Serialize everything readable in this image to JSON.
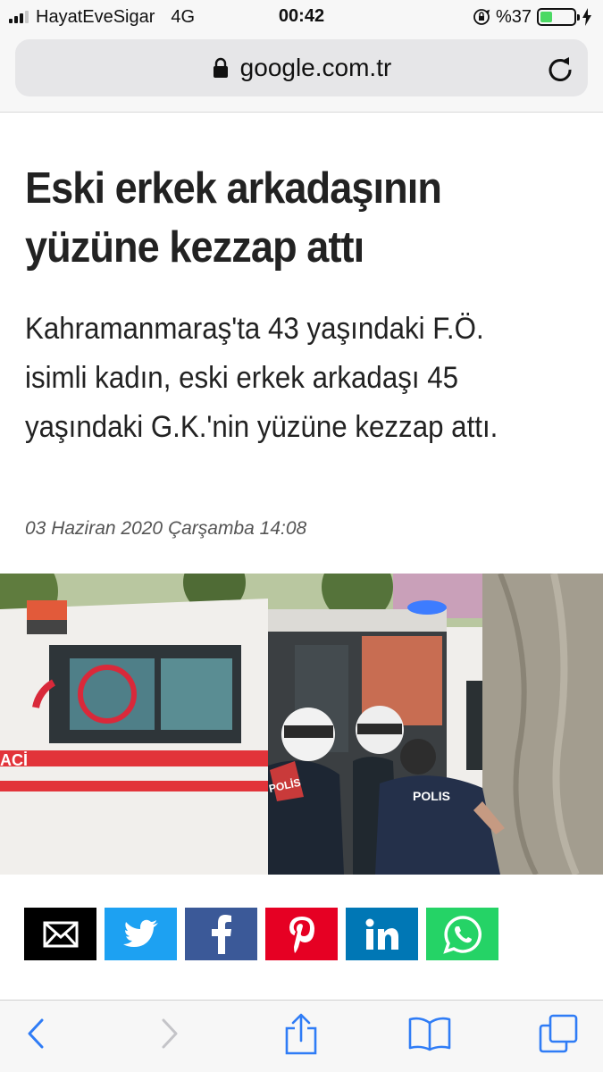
{
  "status_bar": {
    "carrier": "HayatEveSigar",
    "network": "4G",
    "time": "00:42",
    "battery_percent": "%37",
    "battery_level": 0.37,
    "signal_bars": 3,
    "icons": [
      "signal-icon",
      "rotation-lock-icon",
      "battery-icon",
      "charging-bolt-icon"
    ]
  },
  "browser": {
    "url": "google.com.tr",
    "secure_icon": "lock-icon",
    "reload_icon": "reload-icon"
  },
  "article": {
    "headline": "Eski erkek arkadaşının yüzüne kezzap attı",
    "summary": "Kahramanmaraş'ta 43 yaşındaki F.Ö. isimli kadın, eski erkek arkadaşı 45 yaşındaki G.K.'nin yüzüne kezzap attı.",
    "date": "03 Haziran 2020 Çarşamba 14:08",
    "photo_texts": {
      "ambulance_side": "ACİ",
      "police_vest": "POLİS",
      "police_back": "POLIS"
    }
  },
  "share": [
    {
      "name": "email",
      "icon": "envelope-icon",
      "color": "#000000"
    },
    {
      "name": "twitter",
      "icon": "twitter-icon",
      "color": "#1da1f2"
    },
    {
      "name": "facebook",
      "icon": "facebook-icon",
      "color": "#3b5998"
    },
    {
      "name": "pinterest",
      "icon": "pinterest-icon",
      "color": "#e60023"
    },
    {
      "name": "linkedin",
      "icon": "linkedin-icon",
      "color": "#0077b5"
    },
    {
      "name": "whatsapp",
      "icon": "whatsapp-icon",
      "color": "#25d366"
    }
  ],
  "toolbar": {
    "accent": "#2f7cf6",
    "icons": [
      "back-icon",
      "forward-icon",
      "share-icon",
      "bookmarks-icon",
      "tabs-icon"
    ]
  }
}
